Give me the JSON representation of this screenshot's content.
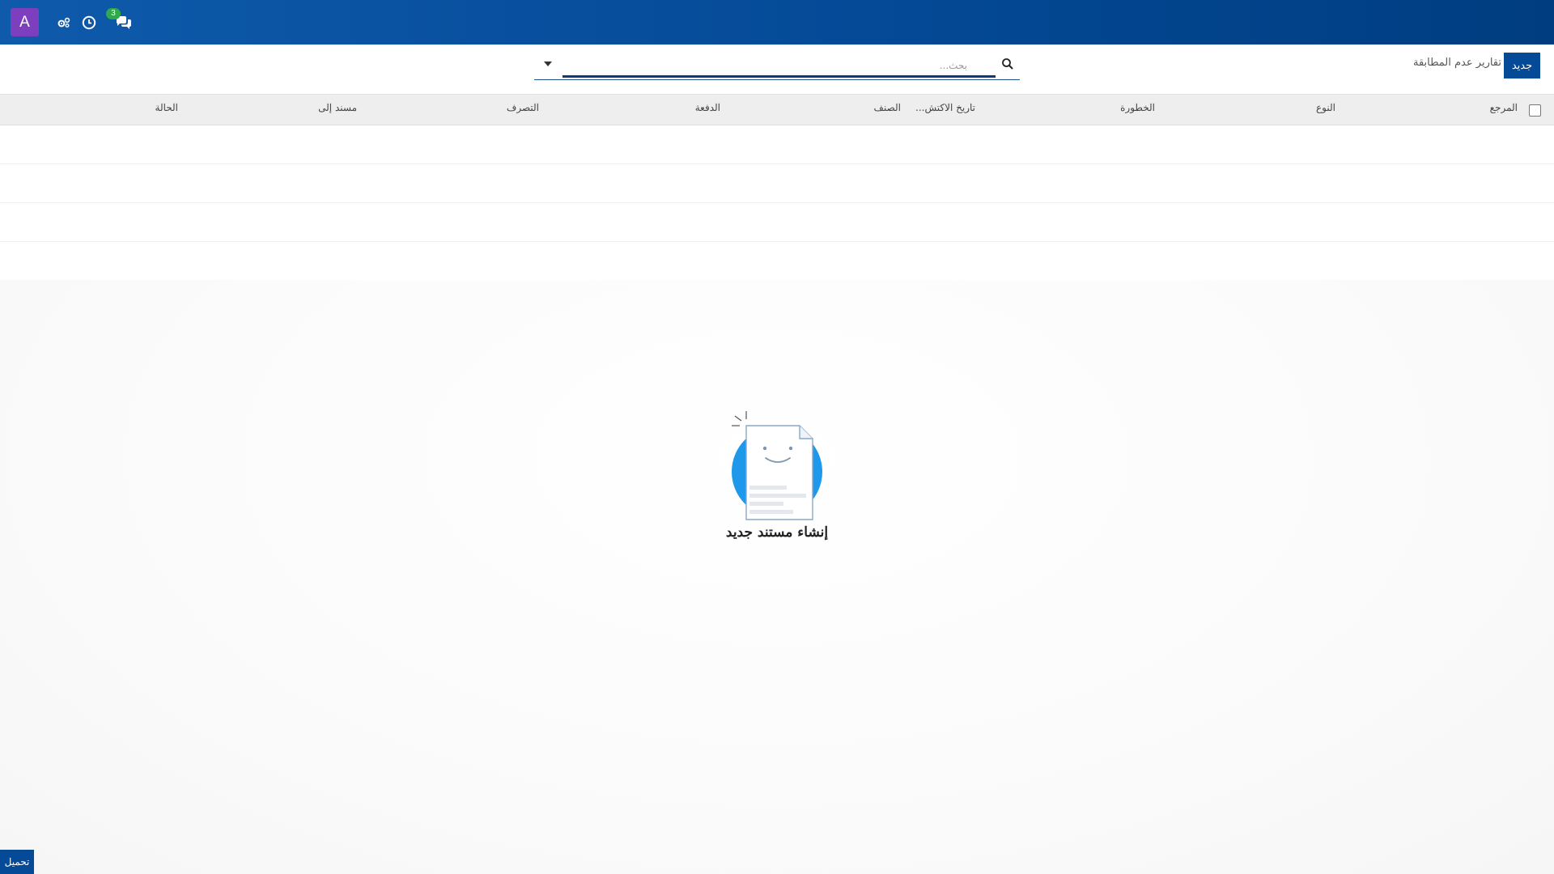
{
  "navbar": {
    "avatar_letter": "A",
    "icons": [
      "settings-users-icon",
      "clock-icon",
      "chat-icon"
    ],
    "chat_badge": "3",
    "background": "#044a97"
  },
  "control_panel": {
    "new_button": "جديد",
    "title": "تقارير عدم المطابقة",
    "search": {
      "placeholder": "بحث..."
    }
  },
  "table": {
    "columns": [
      "المرجع",
      "النوع",
      "الخطورة",
      "تاريخ الاكتش...",
      "الصنف",
      "الدفعة",
      "التصرف",
      "مسند إلى",
      "الحالة"
    ]
  },
  "empty_state": {
    "help_text": "إنشاء مستند جديد"
  },
  "footer": {
    "load_button": "تحميل"
  },
  "colors": {
    "primary": "#044a97",
    "avatar": "#7e3fbf",
    "badge": "#2dab4a",
    "illustration": "#1e98ea"
  }
}
